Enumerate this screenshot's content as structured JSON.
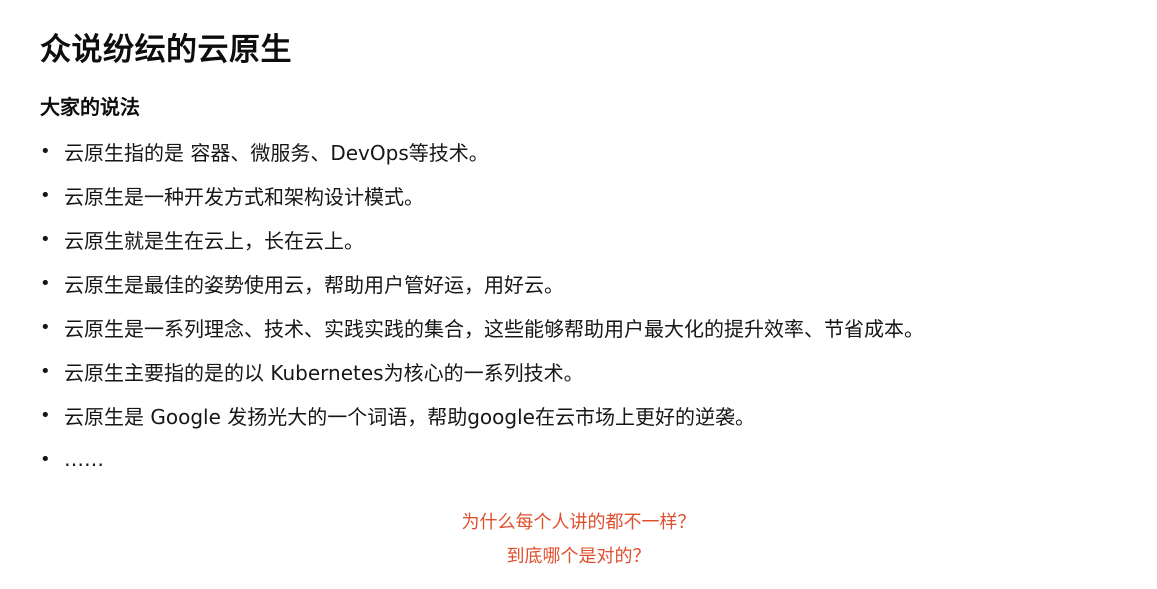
{
  "title": "众说纷纭的云原生",
  "subtitle": "大家的说法",
  "bullet_symbol": "•",
  "bullets": [
    "云原生指的是 容器、微服务、DevOps等技术。",
    "云原生是一种开发方式和架构设计模式。",
    "云原生就是生在云上，长在云上。",
    "云原生是最佳的姿势使用云，帮助用户管好运，用好云。",
    "云原生是一系列理念、技术、实践实践的集合，这些能够帮助用户最大化的提升效率、节省成本。",
    "云原生主要指的是的以 Kubernetes为核心的一系列技术。",
    "云原生是 Google 发扬光大的一个词语，帮助google在云市场上更好的逆袭。",
    "……"
  ],
  "questions": {
    "line1": "为什么每个人讲的都不一样？",
    "line2": "到底哪个是对的？"
  },
  "colors": {
    "question": "#e0502f",
    "text": "#161616"
  }
}
